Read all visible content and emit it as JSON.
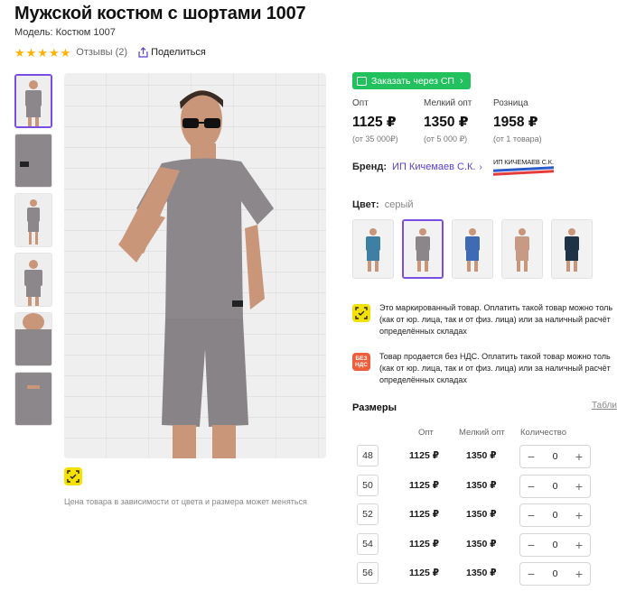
{
  "product": {
    "title": "Мужской костюм с шортами 1007",
    "model": "Модель: Костюм 1007",
    "reviews": "Отзывы (2)",
    "share": "Поделиться",
    "rating_stars": 5
  },
  "order_button": "Заказать через СП",
  "prices": [
    {
      "label": "Опт",
      "value": "1125 ₽",
      "sub": "(от 35 000₽)"
    },
    {
      "label": "Мелкий опт",
      "value": "1350 ₽",
      "sub": "(от 5 000 ₽)"
    },
    {
      "label": "Розница",
      "value": "1958 ₽",
      "sub": "(от 1 товара)"
    }
  ],
  "brand": {
    "label": "Бренд:",
    "name": "ИП Кичемаев С.К.",
    "logo_text": "ИП КИЧЕМАЕВ С.К."
  },
  "color": {
    "label": "Цвет:",
    "value": "серый",
    "swatches": [
      "#3f7fa3",
      "#8a8689",
      "#3e6bb3",
      "#c79a85",
      "#1f3346"
    ],
    "active_index": 1
  },
  "notices": [
    {
      "text": "Это маркированный товар. Оплатить такой товар можно толь\n(как от юр. лица, так и от физ. лица) или за наличный расчёт\nопределённых складах"
    },
    {
      "badge": "БЕЗ НДС",
      "text": "Товар продается без НДС. Оплатить такой товар можно толь\n(как от юр. лица, так и от физ. лица) или за наличный расчёт\nопределённых складах"
    }
  ],
  "price_note": "Цена товара в зависимости от цвета и размера может меняться",
  "sizes": {
    "label": "Размеры",
    "table_link": "Таблиц",
    "columns": {
      "opt": "Опт",
      "small": "Мелкий опт",
      "qty": "Количество"
    },
    "rows": [
      {
        "size": "48",
        "opt": "1125 ₽",
        "small": "1350 ₽",
        "qty": "0"
      },
      {
        "size": "50",
        "opt": "1125 ₽",
        "small": "1350 ₽",
        "qty": "0"
      },
      {
        "size": "52",
        "opt": "1125 ₽",
        "small": "1350 ₽",
        "qty": "0"
      },
      {
        "size": "54",
        "opt": "1125 ₽",
        "small": "1350 ₽",
        "qty": "0"
      },
      {
        "size": "56",
        "opt": "1125 ₽",
        "small": "1350 ₽",
        "qty": "0"
      }
    ]
  },
  "colors": {
    "suit_gray": "#8b878b",
    "accent_purple": "#7a4ee3",
    "link_purple": "#5b3fd6",
    "order_green": "#21c25e",
    "mark_yellow": "#f5e100",
    "vat_red": "#ef5d3a"
  }
}
